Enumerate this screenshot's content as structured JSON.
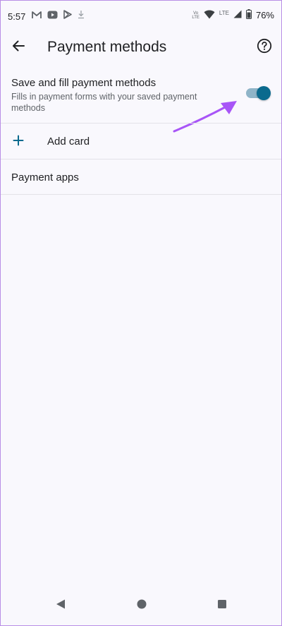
{
  "status_bar": {
    "time": "5:57",
    "network_small_top": "Vo",
    "network_small_bottom": "LTE",
    "lte_label": "LTE",
    "battery_percent": "76%"
  },
  "app_bar": {
    "title": "Payment methods",
    "back_icon": "arrow-back-icon",
    "help_icon": "help-circle-icon"
  },
  "settings": {
    "save_fill": {
      "title": "Save and fill payment methods",
      "summary": "Fills in payment forms with your saved payment methods",
      "enabled": true
    },
    "add_card": {
      "label": "Add card",
      "icon": "plus-icon"
    },
    "payment_apps": {
      "label": "Payment apps"
    }
  },
  "colors": {
    "accent": "#0b6a8e",
    "toggle_track": "#8fb4c8",
    "annotation_arrow": "#a855f7",
    "background": "#f9f8fd"
  },
  "nav_bar": {
    "back_icon": "nav-back-triangle-icon",
    "home_icon": "nav-home-circle-icon",
    "recents_icon": "nav-recents-square-icon"
  }
}
